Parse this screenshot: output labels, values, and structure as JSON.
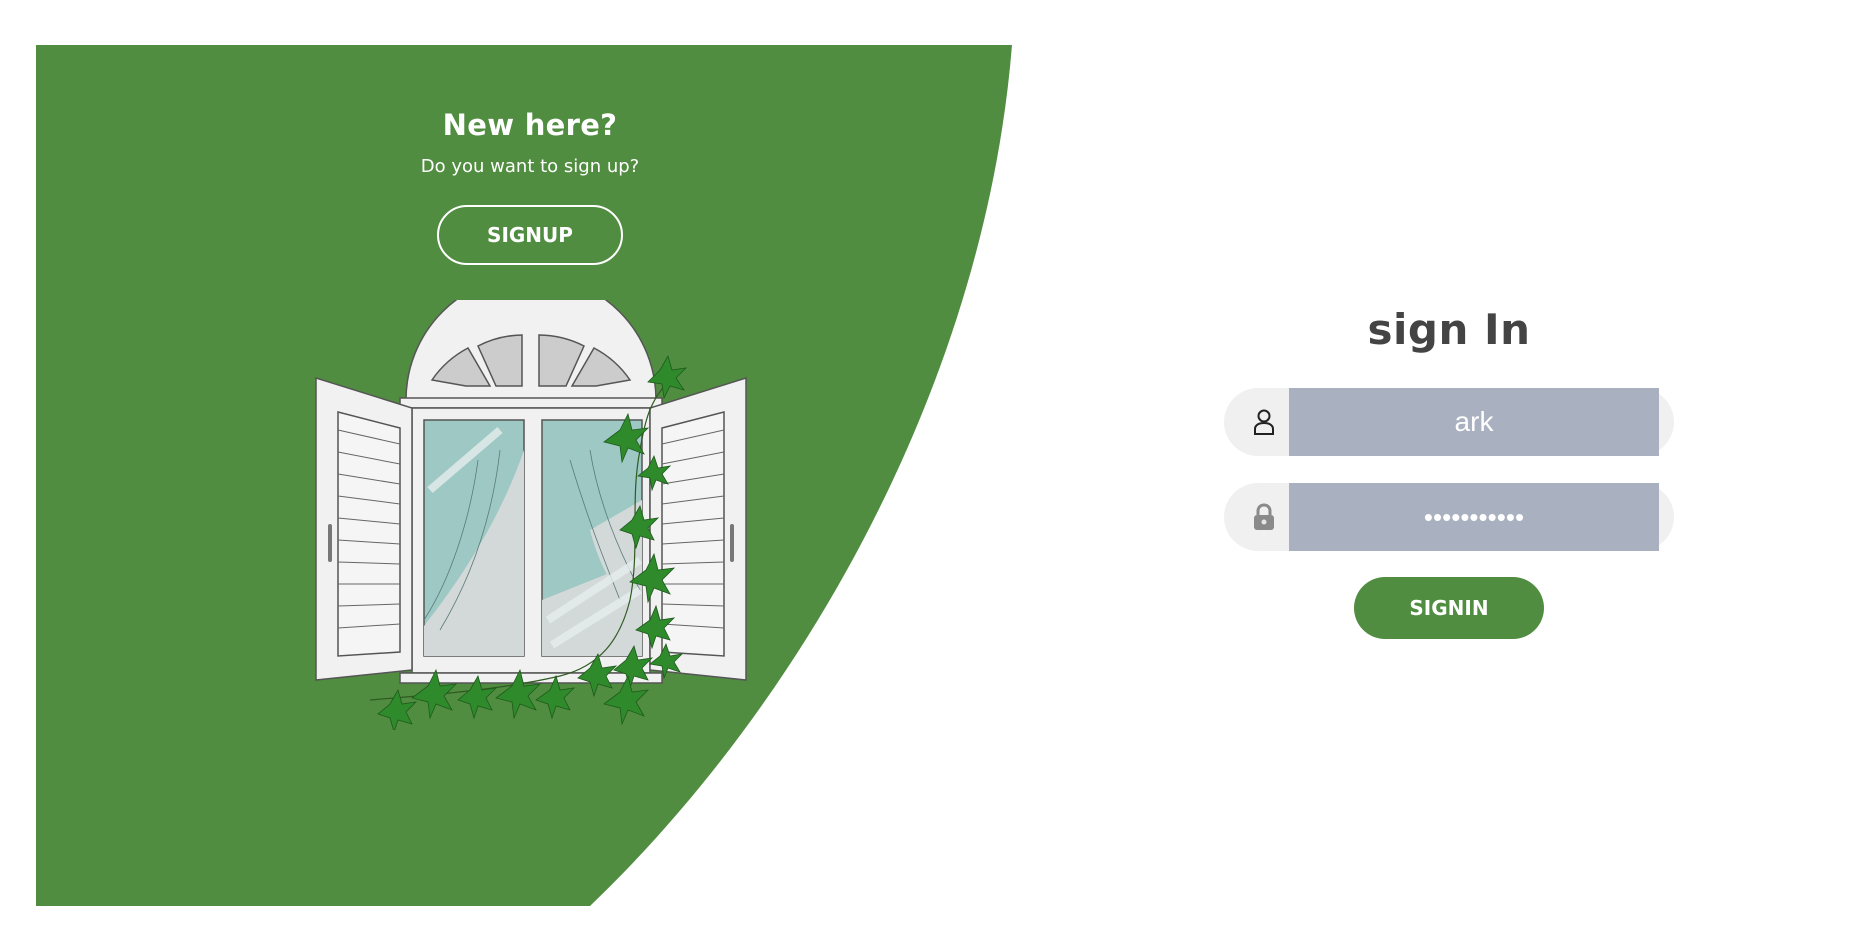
{
  "theme": {
    "accent": "#518d40",
    "input_bg": "#a9b1c0",
    "field_bg": "#f0f0f0",
    "title_color": "#444444"
  },
  "panel": {
    "title": "New here?",
    "subtitle": "Do you want to sign up?",
    "signup_label": "SIGNUP",
    "illustration": "window-with-ivy-illustration"
  },
  "form": {
    "title": "sign In",
    "username": {
      "icon": "user-icon",
      "value": "ark"
    },
    "password": {
      "icon": "lock-icon",
      "value": "•••••••••••"
    },
    "signin_label": "SIGNIN"
  }
}
